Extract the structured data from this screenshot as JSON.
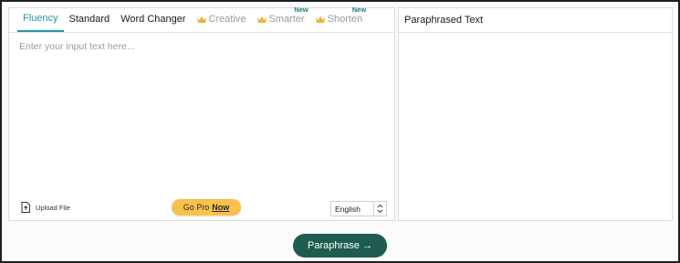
{
  "tabs": [
    {
      "label": "Fluency",
      "active": true,
      "locked": false,
      "new": false
    },
    {
      "label": "Standard",
      "active": false,
      "locked": false,
      "new": false
    },
    {
      "label": "Word Changer",
      "active": false,
      "locked": false,
      "new": false
    },
    {
      "label": "Creative",
      "active": false,
      "locked": true,
      "new": false
    },
    {
      "label": "Smarter",
      "active": false,
      "locked": true,
      "new": true
    },
    {
      "label": "Shorten",
      "active": false,
      "locked": true,
      "new": true
    }
  ],
  "new_badge": "New",
  "input": {
    "placeholder": "Enter your input text here...",
    "value": ""
  },
  "upload_label": "Upload File",
  "gopro": {
    "text": "Go Pro",
    "emphasis": "Now"
  },
  "language": {
    "selected": "English"
  },
  "output_header": "Paraphrased Text",
  "paraphrase_button": "Paraphrase →",
  "colors": {
    "accent": "#1f9aa3",
    "button": "#1d5c4f",
    "gopro": "#f7c14b",
    "crown": "#f0b232"
  }
}
